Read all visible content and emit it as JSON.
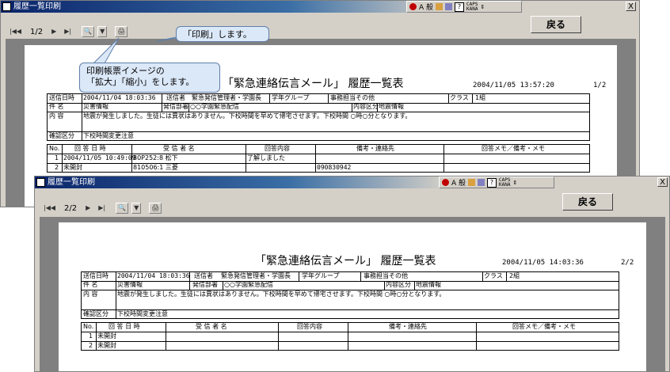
{
  "win1": {
    "title": "履歴一覧印刷",
    "tray": {
      "ime": "A 般",
      "caps": "CAPS",
      "kana": "KANA"
    },
    "close": "X",
    "page": "1/2",
    "back_button": "戻る",
    "report": {
      "title": "「緊急連絡伝言メール」 履歴一覧表",
      "date": "2004/11/05 13:57:20",
      "page": "1/2",
      "send_time_label": "送信日時",
      "send_time": "2004/11/04 18:03:36",
      "sender_label": "送信者",
      "sender": "緊急発信管理者・学園長",
      "group_label": "学年グループ",
      "group": "事務担当その他",
      "class_label": "クラス",
      "class": "1組",
      "subject_label": "件 名",
      "subject": "災害情報",
      "dept_label": "発信部署",
      "dept": "○○学園緊急配信",
      "category_label": "内容区分",
      "category": "地震情報",
      "body_label": "内 容",
      "body": "地震が発生しました。生徒には異状はありません。下校時間を早めて帰宅させます。下校時間 ○時○分となります。",
      "confirm_label": "確認区分",
      "confirm": "下校時間変更注意",
      "headers": [
        "No.",
        "回 答 日 時",
        "受 信 者 名",
        "回答内容",
        "備考・連絡先",
        "回答メモ／備考・メモ"
      ],
      "rows": [
        {
          "no": "1",
          "time": "2004/11/05 10:49:09",
          "name": "80P252:8 松下",
          "answer": "了解しました",
          "note": ""
        },
        {
          "no": "2",
          "time": "未開封",
          "name": "810506:1 三菱",
          "answer": "",
          "note": "090830942"
        }
      ]
    }
  },
  "win2": {
    "title": "履歴一覧印刷",
    "tray": {
      "ime": "A 般",
      "caps": "CAPS",
      "kana": "KANA"
    },
    "close": "X",
    "page": "2/2",
    "back_button": "戻る",
    "report": {
      "title": "「緊急連絡伝言メール」 履歴一覧表",
      "date": "2004/11/05 14:03:36",
      "page": "2/2",
      "send_time_label": "送信日時",
      "send_time": "2004/11/04 18:03:36",
      "sender_label": "送信者",
      "sender": "緊急発信管理者・学園長",
      "group_label": "学年グループ",
      "group": "事務担当その他",
      "class_label": "クラス",
      "class": "2組",
      "subject_label": "件 名",
      "subject": "災害情報",
      "dept_label": "発信部署",
      "dept": "○○学園緊急配信",
      "category_label": "内容区分",
      "category": "地震情報",
      "body_label": "内 容",
      "body": "地震が発生しました。生徒には異状はありません。下校時間を早めて帰宅させます。下校時間 ○時○分となります。",
      "confirm_label": "確認区分",
      "confirm": "下校時間変更注意",
      "headers": [
        "No.",
        "回 答 日 時",
        "受 信 者 名",
        "回答内容",
        "備考・連絡先",
        "回答メモ／備考・メモ"
      ],
      "rows": [
        {
          "no": "1",
          "time": "未開封"
        },
        {
          "no": "2",
          "time": "未開封"
        }
      ]
    }
  },
  "callouts": {
    "print": "「印刷」します。",
    "zoom_line1": "印刷帳票イメージの",
    "zoom_line2": "「拡大」「縮小」をします。"
  }
}
